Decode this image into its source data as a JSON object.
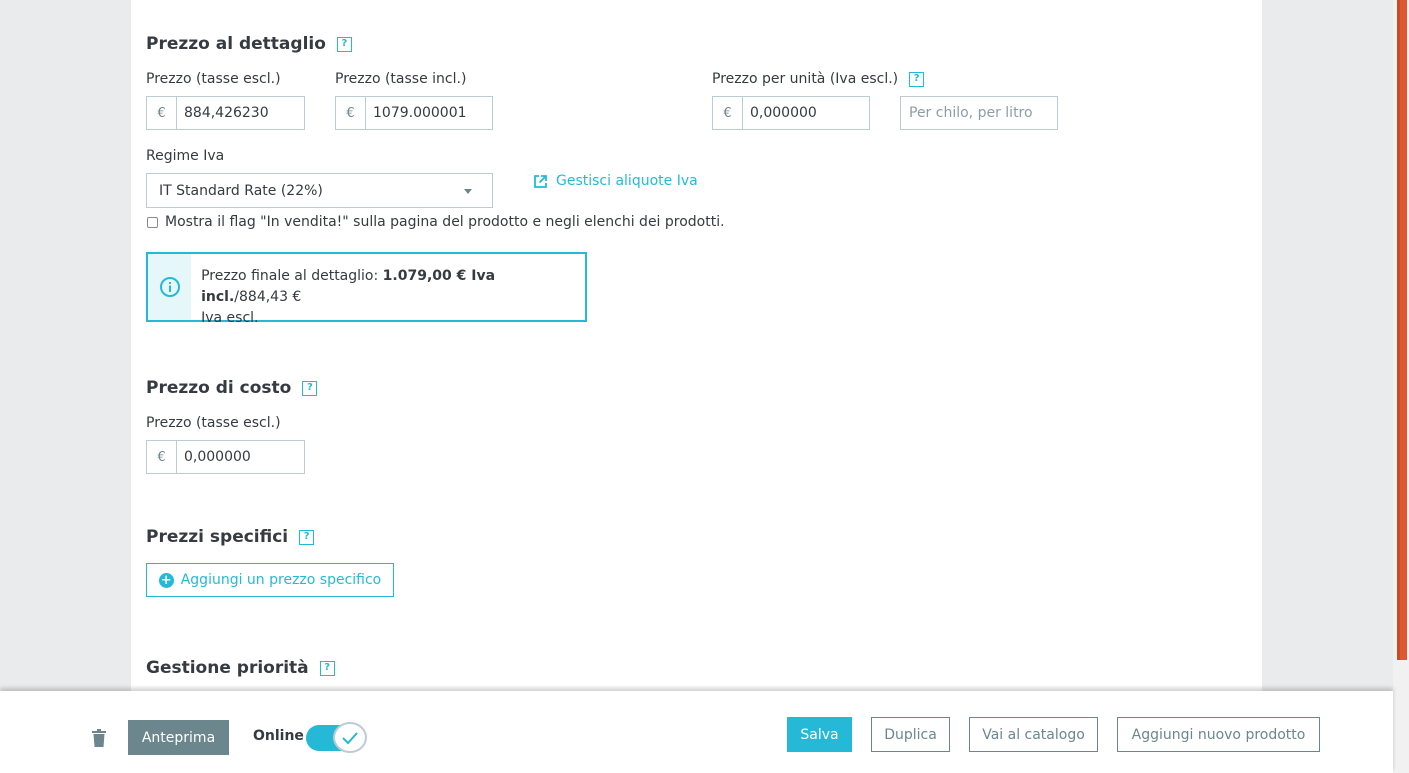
{
  "retail": {
    "title": "Prezzo al dettaglio",
    "help": "?",
    "price_excl_label": "Prezzo (tasse escl.)",
    "price_excl_value": "884,426230",
    "price_incl_label": "Prezzo (tasse incl.)",
    "price_incl_value": "1079.000001",
    "unit_price_label": "Prezzo per unità (Iva escl.)",
    "unit_price_value": "0,000000",
    "unit_placeholder": "Per chilo, per litro",
    "currency": "€",
    "tax_rule_label": "Regime Iva",
    "tax_rule_value": "IT Standard Rate (22%)",
    "manage_tax_link": "Gestisci aliquote Iva",
    "on_sale_label": "Mostra il flag \"In vendita!\" sulla pagina del prodotto e negli elenchi dei prodotti.",
    "on_sale_checked": false,
    "final_price_prefix": "Prezzo finale al dettaglio: ",
    "final_price_bold": "1.079,00 € Iva incl.",
    "final_price_suffix": "/884,43 €",
    "final_price_line2": "Iva escl."
  },
  "cost": {
    "title": "Prezzo di costo",
    "help": "?",
    "price_label": "Prezzo (tasse escl.)",
    "price_value": "0,000000",
    "currency": "€"
  },
  "specific": {
    "title": "Prezzi specifici",
    "help": "?",
    "add_button": "Aggiungi un prezzo specifico",
    "add_icon": "+"
  },
  "priority": {
    "title": "Gestione priorità",
    "help": "?"
  },
  "footer": {
    "preview_button": "Anteprima",
    "online_label": "Online",
    "online_enabled": true,
    "save_button": "Salva",
    "duplicate_button": "Duplica",
    "catalog_button": "Vai al catalogo",
    "new_product_button": "Aggiungi nuovo prodotto"
  },
  "colors": {
    "accent": "#25b9d7",
    "text": "#363a41",
    "muted": "#6c868e",
    "border": "#bbcdd2",
    "scrollbar": "#e0582f"
  }
}
